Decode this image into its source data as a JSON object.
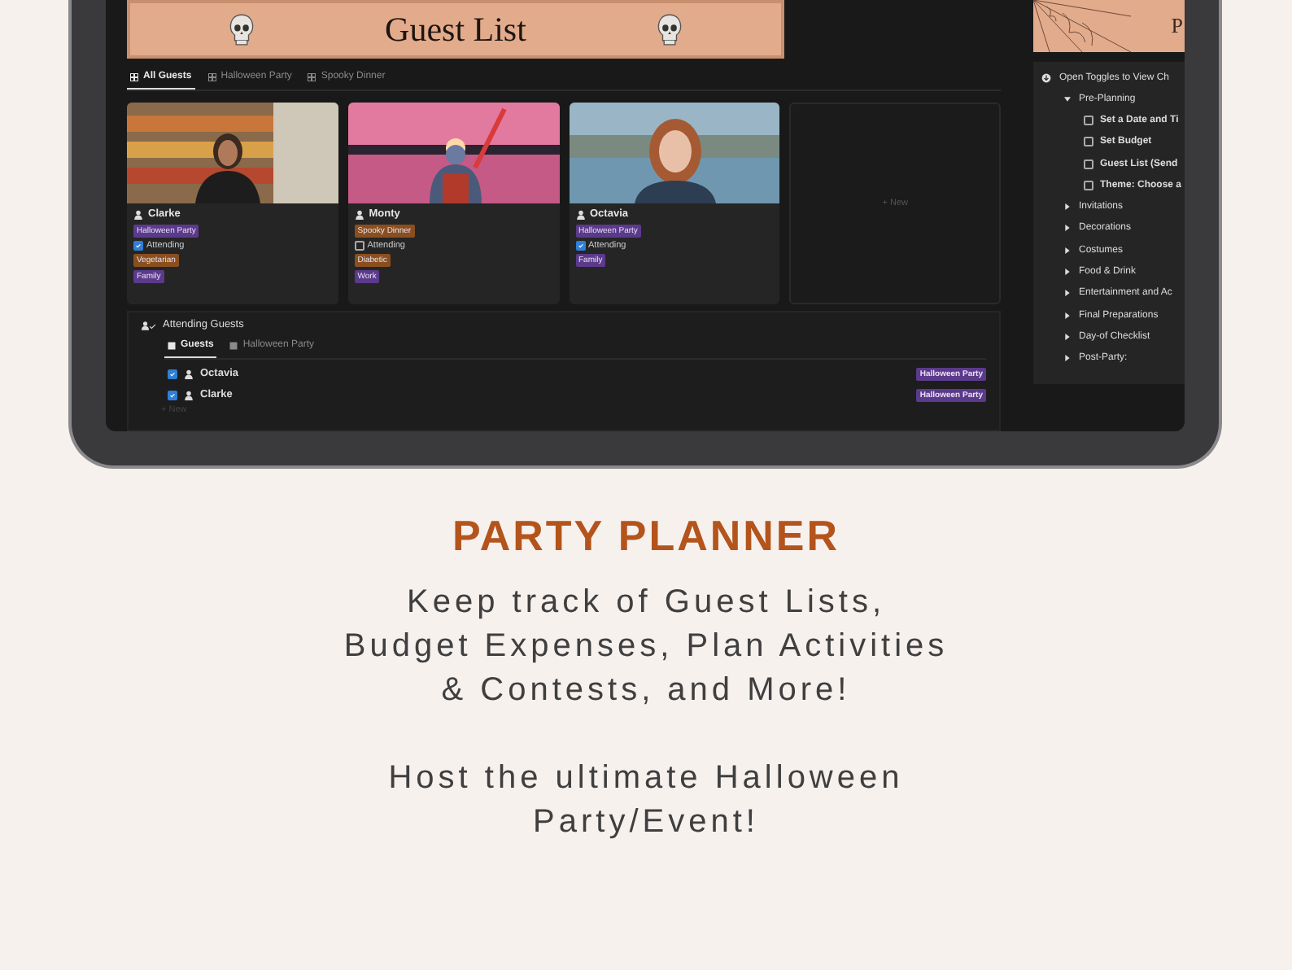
{
  "banner": {
    "title": "Guest List"
  },
  "views": [
    {
      "label": "All Guests",
      "selected": true
    },
    {
      "label": "Halloween Party",
      "selected": false
    },
    {
      "label": "Spooky Dinner",
      "selected": false
    }
  ],
  "guests": [
    {
      "name": "Clarke",
      "event": {
        "text": "Halloween Party",
        "color": "#5b3a8c"
      },
      "attending": true,
      "attending_label": "Attending",
      "tags": [
        {
          "text": "Vegetarian",
          "color": "#8a4f1e"
        },
        {
          "text": "Family",
          "color": "#5b3a8c"
        }
      ]
    },
    {
      "name": "Monty",
      "event": {
        "text": "Spooky Dinner",
        "color": "#8a4f1e"
      },
      "attending": false,
      "attending_label": "Attending",
      "tags": [
        {
          "text": "Diabetic",
          "color": "#8a4f1e"
        },
        {
          "text": "Work",
          "color": "#5b3a8c"
        }
      ]
    },
    {
      "name": "Octavia",
      "event": {
        "text": "Halloween Party",
        "color": "#5b3a8c"
      },
      "attending": true,
      "attending_label": "Attending",
      "tags": [
        {
          "text": "Family",
          "color": "#5b3a8c"
        }
      ]
    }
  ],
  "new_card": "+ New",
  "attending": {
    "title": "Attending Guests",
    "views": [
      {
        "label": "Guests",
        "selected": true
      },
      {
        "label": "Halloween Party",
        "selected": false
      }
    ],
    "rows": [
      {
        "name": "Octavia",
        "checked": true,
        "event": "Halloween Party"
      },
      {
        "name": "Clarke",
        "checked": true,
        "event": "Halloween Party"
      }
    ],
    "new_row": "+ New"
  },
  "side": {
    "header": "P",
    "intro": "Open Toggles to View Ch",
    "sections": [
      {
        "label": "Pre-Planning",
        "expanded": true,
        "children": [
          {
            "label": "Set a Date and Ti",
            "checked": false
          },
          {
            "label": "Set Budget",
            "checked": false
          },
          {
            "label": "Guest List (Send",
            "checked": false
          },
          {
            "label": "Theme: Choose a",
            "checked": false
          }
        ]
      },
      {
        "label": "Invitations",
        "expanded": false
      },
      {
        "label": "Decorations",
        "expanded": false
      },
      {
        "label": "Costumes",
        "expanded": false
      },
      {
        "label": "Food & Drink",
        "expanded": false
      },
      {
        "label": "Entertainment and Ac",
        "expanded": false
      },
      {
        "label": "Final Preparations",
        "expanded": false
      },
      {
        "label": "Day-of Checklist",
        "expanded": false
      },
      {
        "label": "Post-Party:",
        "expanded": false
      }
    ]
  },
  "promo": {
    "title": "PARTY PLANNER",
    "paragraphs": [
      "Keep track of Guest Lists,\nBudget Expenses, Plan Activities\n& Contests, and More!",
      "Host the ultimate Halloween\nParty/Event!"
    ]
  }
}
